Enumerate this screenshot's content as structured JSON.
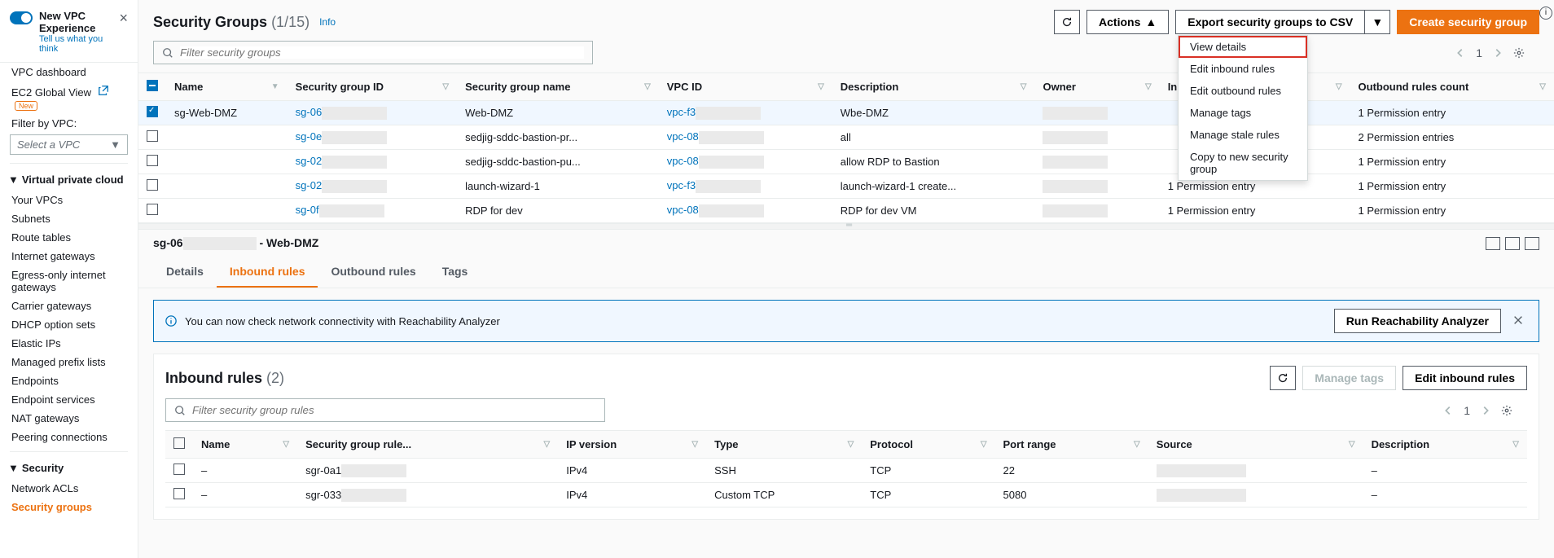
{
  "sidebar": {
    "new_title": "New VPC Experience",
    "new_sub": "Tell us what you think",
    "dashboard": "VPC dashboard",
    "global_view": "EC2 Global View",
    "global_view_new": "New",
    "filter_label": "Filter by VPC:",
    "filter_placeholder": "Select a VPC",
    "sec_vpc": "Virtual private cloud",
    "vpc_items": [
      "Your VPCs",
      "Subnets",
      "Route tables",
      "Internet gateways",
      "Egress-only internet gateways",
      "Carrier gateways",
      "DHCP option sets",
      "Elastic IPs",
      "Managed prefix lists",
      "Endpoints",
      "Endpoint services",
      "NAT gateways",
      "Peering connections"
    ],
    "sec_security": "Security",
    "security_items": [
      "Network ACLs",
      "Security groups"
    ]
  },
  "header": {
    "title": "Security Groups",
    "count": "(1/15)",
    "info": "Info",
    "actions_btn": "Actions",
    "export_btn": "Export security groups to CSV",
    "create_btn": "Create security group",
    "search_placeholder": "Filter security groups",
    "page": "1",
    "dropdown": [
      "View details",
      "Edit inbound rules",
      "Edit outbound rules",
      "Manage tags",
      "Manage stale rules",
      "Copy to new security group"
    ]
  },
  "cols": [
    "Name",
    "Security group ID",
    "Security group name",
    "VPC ID",
    "Description",
    "Owner",
    "Inbound rules count",
    "Outbound rules count"
  ],
  "rows": [
    {
      "sel": true,
      "name": "sg-Web-DMZ",
      "sgid": "sg-06",
      "sgname": "Web-DMZ",
      "vpc": "vpc-f3",
      "desc": "Wbe-DMZ",
      "in": "",
      "out": "1 Permission entry"
    },
    {
      "sel": false,
      "name": "",
      "sgid": "sg-0e",
      "sgname": "sedjig-sddc-bastion-pr...",
      "vpc": "vpc-08",
      "desc": "all",
      "in": "",
      "out": "2 Permission entries"
    },
    {
      "sel": false,
      "name": "",
      "sgid": "sg-02",
      "sgname": "sedjig-sddc-bastion-pu...",
      "vpc": "vpc-08",
      "desc": "allow RDP to Bastion",
      "in": "",
      "out": "1 Permission entry"
    },
    {
      "sel": false,
      "name": "",
      "sgid": "sg-02",
      "sgname": "launch-wizard-1",
      "vpc": "vpc-f3",
      "desc": "launch-wizard-1 create...",
      "in": "1 Permission entry",
      "out": "1 Permission entry"
    },
    {
      "sel": false,
      "name": "",
      "sgid": "sg-0f",
      "sgname": "RDP for dev",
      "vpc": "vpc-08",
      "desc": "RDP for dev VM",
      "in": "1 Permission entry",
      "out": "1 Permission entry"
    }
  ],
  "detail": {
    "title_prefix": "sg-06",
    "title_suffix": " - Web-DMZ",
    "tabs": [
      "Details",
      "Inbound rules",
      "Outbound rules",
      "Tags"
    ],
    "alert_text": "You can now check network connectivity with Reachability Analyzer",
    "alert_btn": "Run Reachability Analyzer",
    "panel_title": "Inbound rules",
    "panel_count": "(2)",
    "refresh": "",
    "manage_tags": "Manage tags",
    "edit_inbound": "Edit inbound rules",
    "search_placeholder": "Filter security group rules",
    "page": "1",
    "cols": [
      "Name",
      "Security group rule...",
      "IP version",
      "Type",
      "Protocol",
      "Port range",
      "Source",
      "Description"
    ],
    "rows": [
      {
        "name": "–",
        "sgr": "sgr-0a1",
        "ipv": "IPv4",
        "type": "SSH",
        "proto": "TCP",
        "port": "22",
        "src": "",
        "desc": "–"
      },
      {
        "name": "–",
        "sgr": "sgr-033",
        "ipv": "IPv4",
        "type": "Custom TCP",
        "proto": "TCP",
        "port": "5080",
        "src": "",
        "desc": "–"
      }
    ]
  }
}
